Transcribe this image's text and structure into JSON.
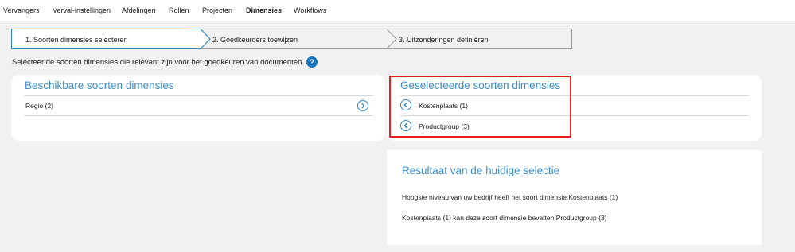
{
  "nav": {
    "items": [
      "Vervangers",
      "Verval-instellingen",
      "Afdelingen",
      "Rollen",
      "Projecten",
      "Dimensies",
      "Workflows"
    ],
    "active": "Dimensies"
  },
  "stepper": {
    "steps": [
      "1. Soorten dimensies selecteren",
      "2. Goedkeurders toewijzen",
      "3. Uitzonderingen definiëren"
    ],
    "active_index": 0,
    "active_color": "#2f86c4"
  },
  "instruction": "Selecteer de soorten dimensies die relevant zijn voor het goedkeuren van documenten",
  "help_icon": {
    "symbol": "?",
    "name": "question-mark-icon"
  },
  "available": {
    "title": "Beschikbare soorten dimensies",
    "items": [
      "Regio (2)"
    ],
    "icon": "chevron-right-circle-icon"
  },
  "selected": {
    "title": "Geselecteerde soorten dimensies",
    "items": [
      "Kostenplaats (1)",
      "Productgroup (3)"
    ],
    "icon": "chevron-left-circle-icon",
    "highlight_color": "#e0201e"
  },
  "result": {
    "title": "Resultaat van de huidige selectie",
    "lines": [
      "Hoogste niveau van uw bedrijf heeft het soort dimensie Kostenplaats (1)",
      "Kostenplaats (1) kan deze soort dimensie bevatten Productgroup (3)"
    ]
  },
  "colors": {
    "accent": "#3a8ec8",
    "page_bg": "#f1f1f1",
    "card_bg": "#ffffff"
  }
}
